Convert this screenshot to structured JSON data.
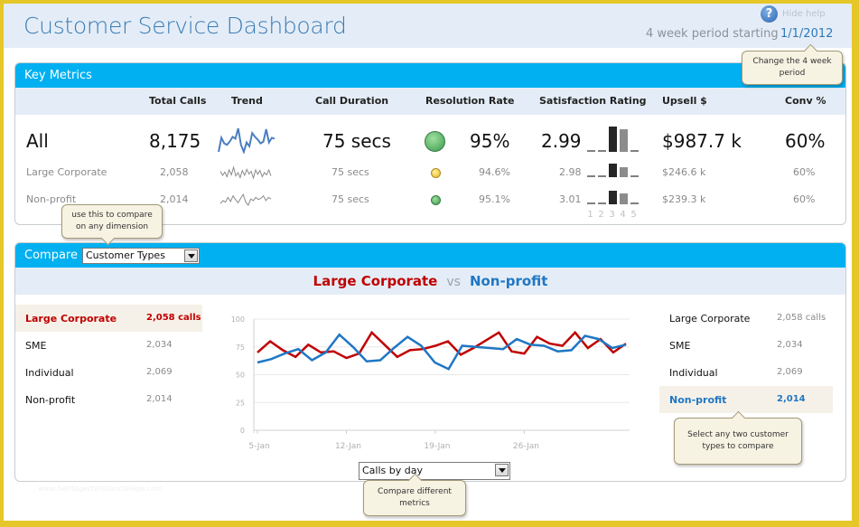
{
  "header": {
    "title": "Customer Service Dashboard",
    "help_label": "Hide help",
    "period_label": "4 week period starting",
    "period_date": "1/1/2012"
  },
  "tooltips": {
    "period": "Change the 4 week period",
    "compare": "use this to compare on any dimension",
    "select_types": "Select any two customer types to compare",
    "metrics": "Compare different metrics"
  },
  "key_metrics": {
    "title": "Key Metrics",
    "columns": [
      "Total Calls",
      "Trend",
      "Call Duration",
      "Resolution Rate",
      "Satisfaction Rating",
      "Upsell $",
      "Conv %"
    ],
    "rows": [
      {
        "name": "All",
        "total_calls": "8,175",
        "call_duration": "75 secs",
        "resolution_status": "green",
        "resolution_rate": "95%",
        "satisfaction": "2.99",
        "satisfaction_dist": [
          0.02,
          0.04,
          1.0,
          0.9,
          0.02
        ],
        "upsell": "$987.7 k",
        "conv": "60%",
        "trend": [
          40,
          70,
          58,
          55,
          62,
          72,
          68,
          90,
          55,
          40,
          60,
          52,
          80,
          72,
          66,
          58,
          62,
          88,
          60,
          70,
          68
        ]
      },
      {
        "name": "Large Corporate",
        "total_calls": "2,058",
        "call_duration": "75 secs",
        "resolution_status": "yellow",
        "resolution_rate": "94.6%",
        "satisfaction": "2.98",
        "satisfaction_dist": [
          0.0,
          0.05,
          1.0,
          0.75,
          0.05
        ],
        "upsell": "$246.6 k",
        "conv": "60%",
        "trend": [
          55,
          40,
          52,
          35,
          60,
          42,
          70,
          38,
          50,
          32,
          58,
          40,
          62,
          45,
          55,
          30,
          60,
          44,
          58,
          35,
          50,
          42,
          60,
          38
        ]
      },
      {
        "name": "Non-profit",
        "total_calls": "2,014",
        "call_duration": "75 secs",
        "resolution_status": "green",
        "resolution_rate": "95.1%",
        "satisfaction": "3.01",
        "satisfaction_dist": [
          0.05,
          0.05,
          1.0,
          0.8,
          0.05
        ],
        "upsell": "$239.3 k",
        "conv": "60%",
        "trend": [
          35,
          45,
          40,
          55,
          42,
          60,
          48,
          38,
          52,
          65,
          40,
          30,
          50,
          45,
          55,
          48,
          52,
          60,
          45,
          55,
          50
        ]
      }
    ],
    "rating_scale": [
      "1",
      "2",
      "3",
      "4",
      "5"
    ]
  },
  "compare": {
    "title": "Compare",
    "dimension": "Customer Types",
    "series_a": "Large Corporate",
    "vs": "vs",
    "series_b": "Non-profit",
    "left_list": [
      {
        "name": "Large Corporate",
        "value": "2,058 calls",
        "selected": "red"
      },
      {
        "name": "SME",
        "value": "2,034",
        "selected": ""
      },
      {
        "name": "Individual",
        "value": "2,069",
        "selected": ""
      },
      {
        "name": "Non-profit",
        "value": "2,014",
        "selected": ""
      }
    ],
    "right_list": [
      {
        "name": "Large Corporate",
        "value": "2,058 calls",
        "selected": ""
      },
      {
        "name": "SME",
        "value": "2,034",
        "selected": ""
      },
      {
        "name": "Individual",
        "value": "2,069",
        "selected": ""
      },
      {
        "name": "Non-profit",
        "value": "2,014",
        "selected": "blue"
      }
    ],
    "metric": "Calls by day"
  },
  "chart_data": {
    "type": "line",
    "title": "",
    "xlabel": "",
    "ylabel": "",
    "ylim": [
      0,
      100
    ],
    "yticks": [
      "0",
      "25",
      "50",
      "75",
      "100"
    ],
    "xticks": [
      "5-Jan",
      "12-Jan",
      "19-Jan",
      "26-Jan"
    ],
    "grid": true,
    "legend": "none",
    "x": [
      "5-Jan",
      "6-Jan",
      "7-Jan",
      "8-Jan",
      "9-Jan",
      "10-Jan",
      "11-Jan",
      "12-Jan",
      "13-Jan",
      "14-Jan",
      "15-Jan",
      "16-Jan",
      "17-Jan",
      "18-Jan",
      "19-Jan",
      "20-Jan",
      "21-Jan",
      "22-Jan",
      "23-Jan",
      "24-Jan",
      "25-Jan",
      "26-Jan",
      "27-Jan",
      "28-Jan",
      "29-Jan",
      "30-Jan",
      "31-Jan",
      "1-Feb",
      "2-Feb"
    ],
    "series": [
      {
        "name": "Large Corporate",
        "color": "#c00000",
        "values": [
          70,
          80,
          72,
          66,
          77,
          70,
          71,
          65,
          69,
          88,
          77,
          66,
          72,
          73,
          76,
          80,
          68,
          74,
          81,
          88,
          71,
          69,
          84,
          78,
          76,
          88,
          74,
          82,
          70,
          78
        ]
      },
      {
        "name": "Non-profit",
        "color": "#1f77c4",
        "values": [
          61,
          64,
          69,
          73,
          63,
          70,
          86,
          75,
          62,
          63,
          74,
          84,
          76,
          61,
          55,
          76,
          75,
          74,
          73,
          82,
          77,
          76,
          71,
          72,
          85,
          82,
          74,
          77
        ]
      }
    ]
  },
  "watermark": "www.heritagechristiancollege.com"
}
